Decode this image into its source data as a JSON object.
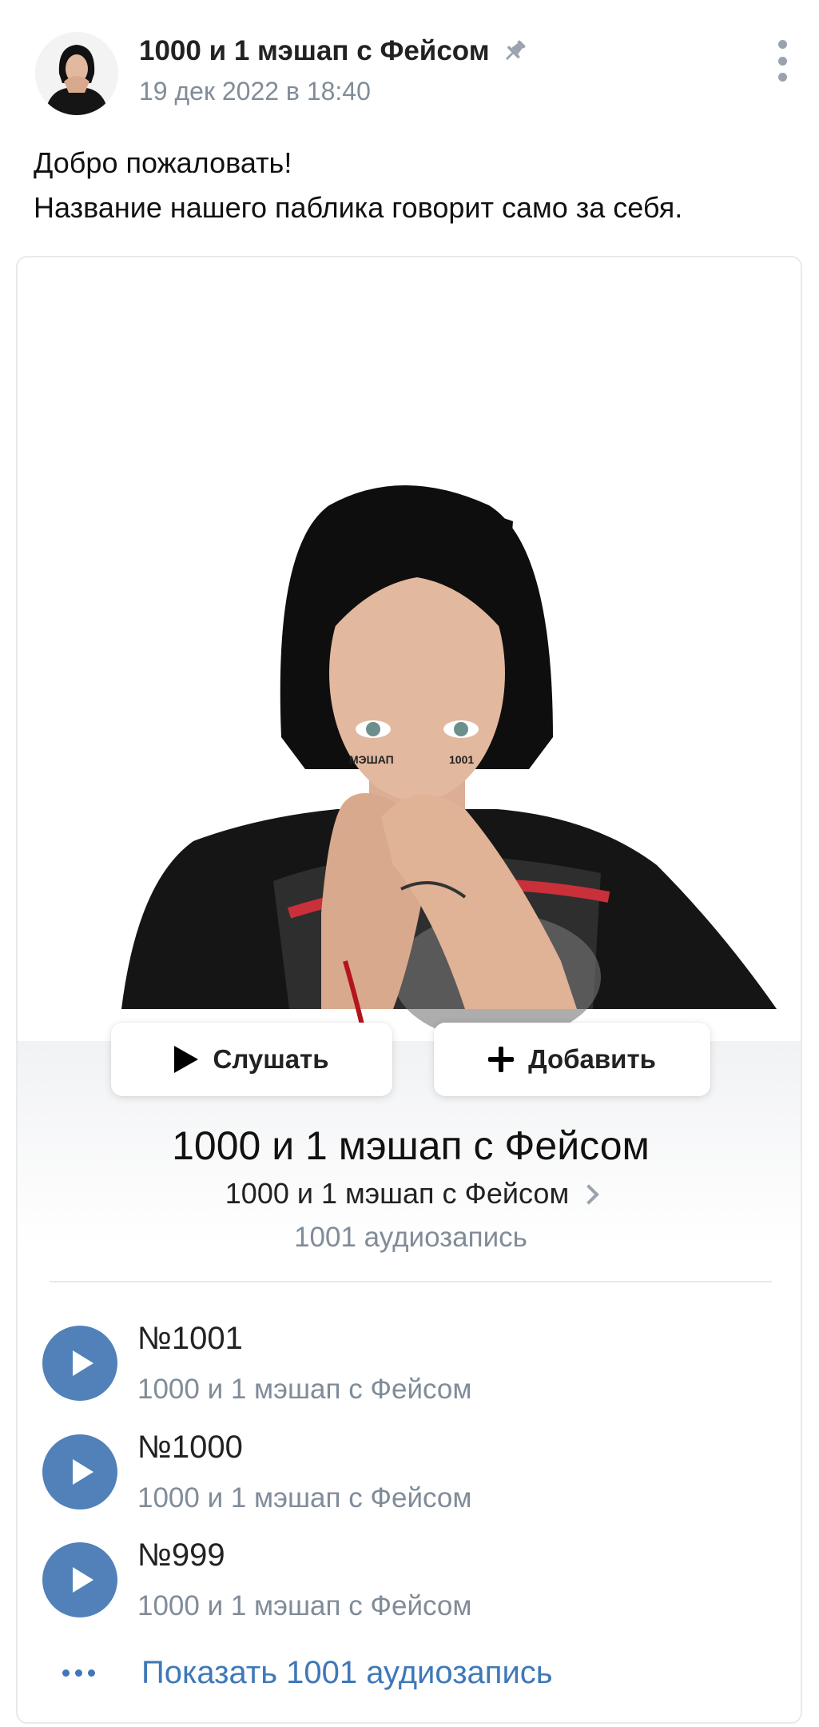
{
  "post": {
    "author": "1000 и 1 мэшап с Фейсом",
    "date": "19 дек 2022 в 18:40",
    "text_line1": "Добро пожаловать!",
    "text_line2": "Название нашего паблика говорит само за себя."
  },
  "playlist": {
    "cover_text_left": "МЭШАП",
    "cover_text_right": "1001",
    "listen_label": "Слушать",
    "add_label": "Добавить",
    "title": "1000 и 1 мэшап с Фейсом",
    "owner": "1000 и 1 мэшап с Фейсом",
    "count": "1001 аудиозапись",
    "tracks": [
      {
        "title": "№1001",
        "artist": "1000 и 1 мэшап с Фейсом"
      },
      {
        "title": "№1000",
        "artist": "1000 и 1 мэшап с Фейсом"
      },
      {
        "title": "№999",
        "artist": "1000 и 1 мэшап с Фейсом"
      }
    ],
    "show_more": "Показать 1001 аудиозапись"
  },
  "colors": {
    "accent": "#5181b8",
    "link": "#3f78b8",
    "secondary_text": "#818c99"
  }
}
